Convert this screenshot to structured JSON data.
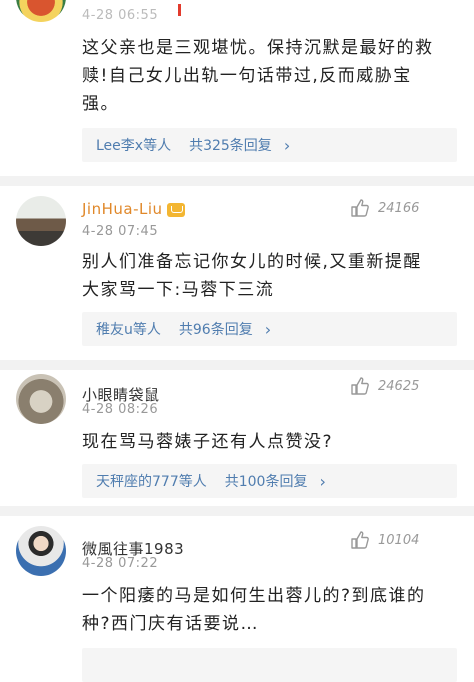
{
  "comments": [
    {
      "time": "4-28 06:55",
      "text_line1": "这父亲也是三观堪忧。保持沉默是最好的救",
      "text_line2": "赎!自己女儿出轨一句话带过,反而威胁宝",
      "text_line3": "强。",
      "reply_who": "Lee李x等人",
      "reply_count": "共325条回复"
    },
    {
      "username": "JinHua-Liu",
      "time": "4-28 07:45",
      "likes": "24166",
      "text_line1": "别人们准备忘记你女儿的时候,又重新提醒",
      "text_line2": "大家骂一下:马蓉下三流",
      "reply_who": "稚友u等人",
      "reply_count": "共96条回复"
    },
    {
      "username": "小眼睛袋鼠",
      "time": "4-28 08:26",
      "likes": "24625",
      "text_line1": "现在骂马蓉婊子还有人点赞没?",
      "reply_who": "天秤座的777等人",
      "reply_count": "共100条回复"
    },
    {
      "username": "微風往事1983",
      "time": "4-28 07:22",
      "likes": "10104",
      "text_line1": "一个阳痿的马是如何生出蓉儿的?到底谁的",
      "text_line2": "种?西门庆有话要说…"
    }
  ],
  "icons": {
    "like": "thumbs-up-icon",
    "chevron": "chevron-right-icon",
    "badge": "crown-badge-icon"
  },
  "colors": {
    "link": "#507daf",
    "username_vip": "#e0882a",
    "meta": "#999999",
    "reply_bg": "#f5f5f5"
  }
}
